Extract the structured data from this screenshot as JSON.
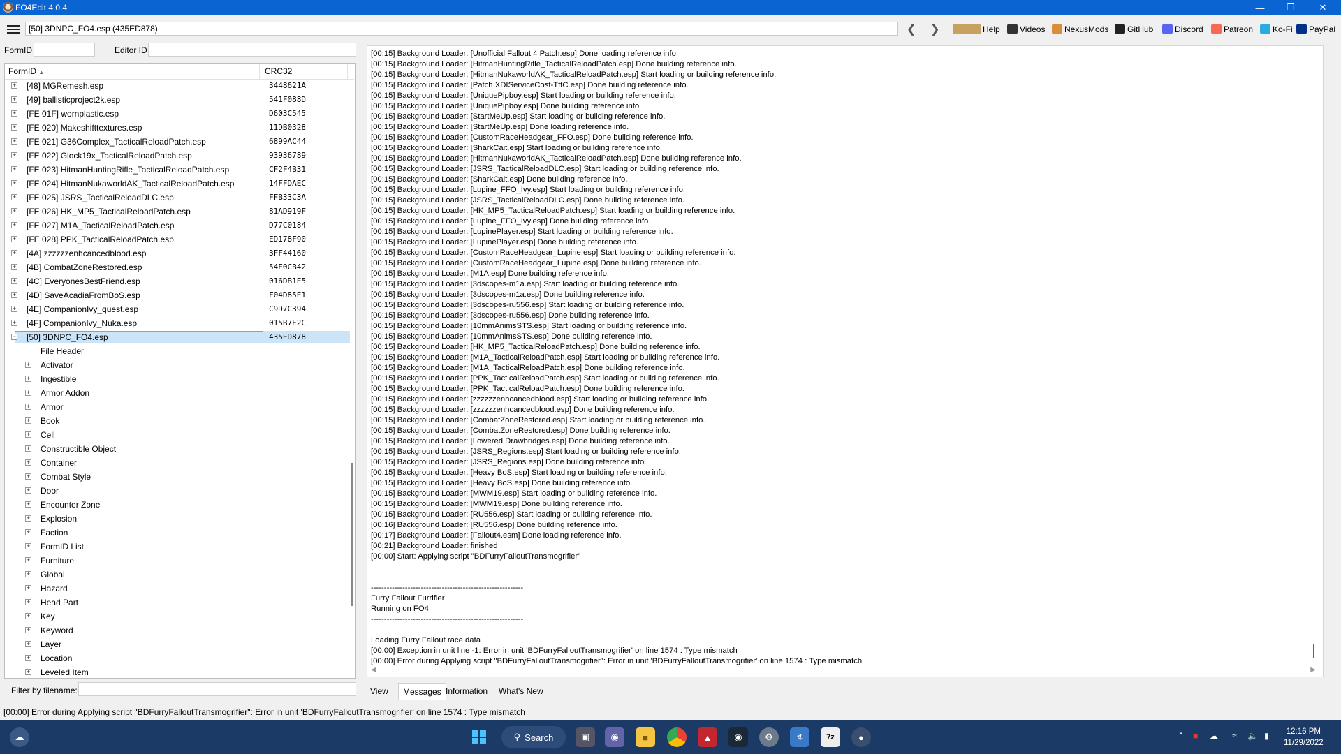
{
  "window": {
    "title": "FO4Edit 4.0.4"
  },
  "toolbar": {
    "path": "[50] 3DNPC_FO4.esp (435ED878)",
    "links": [
      {
        "label": "Help",
        "icon": "book-icon",
        "color": "#c8a060"
      },
      {
        "label": "Videos",
        "icon": "video-icon",
        "color": "#333333"
      },
      {
        "label": "NexusMods",
        "icon": "nexus-icon",
        "color": "#d98f3a"
      },
      {
        "label": "GitHub",
        "icon": "github-icon",
        "color": "#222222"
      },
      {
        "label": "Discord",
        "icon": "discord-icon",
        "color": "#5865f2"
      },
      {
        "label": "Patreon",
        "icon": "patreon-icon",
        "color": "#f96854"
      },
      {
        "label": "Ko-Fi",
        "icon": "kofi-icon",
        "color": "#29abe0"
      },
      {
        "label": "PayPal",
        "icon": "paypal-icon",
        "color": "#003087"
      }
    ]
  },
  "filters": {
    "formid_label": "FormID",
    "editorid_label": "Editor ID",
    "filename_label": "Filter by filename:"
  },
  "tree": {
    "col_formid": "FormID",
    "col_crc": "CRC32",
    "plugins": [
      {
        "name": "[48] MGRemesh.esp",
        "crc": "3448621A"
      },
      {
        "name": "[49] ballisticproject2k.esp",
        "crc": "541F088D"
      },
      {
        "name": "[FE 01F] wornplastic.esp",
        "crc": "D603C545"
      },
      {
        "name": "[FE 020] Makeshifttextures.esp",
        "crc": "11DB0328"
      },
      {
        "name": "[FE 021] G36Complex_TacticalReloadPatch.esp",
        "crc": "6899AC44"
      },
      {
        "name": "[FE 022] Glock19x_TacticalReloadPatch.esp",
        "crc": "93936789"
      },
      {
        "name": "[FE 023] HitmanHuntingRifle_TacticalReloadPatch.esp",
        "crc": "CF2F4B31"
      },
      {
        "name": "[FE 024] HitmanNukaworldAK_TacticalReloadPatch.esp",
        "crc": "14FFDAEC"
      },
      {
        "name": "[FE 025] JSRS_TacticalReloadDLC.esp",
        "crc": "FFB33C3A"
      },
      {
        "name": "[FE 026] HK_MP5_TacticalReloadPatch.esp",
        "crc": "81AD919F"
      },
      {
        "name": "[FE 027] M1A_TacticalReloadPatch.esp",
        "crc": "D77C0184"
      },
      {
        "name": "[FE 028] PPK_TacticalReloadPatch.esp",
        "crc": "ED178F90"
      },
      {
        "name": "[4A] zzzzzzenhcancedblood.esp",
        "crc": "3FF44160"
      },
      {
        "name": "[4B] CombatZoneRestored.esp",
        "crc": "54E0CB42"
      },
      {
        "name": "[4C] EveryonesBestFriend.esp",
        "crc": "016DB1E5"
      },
      {
        "name": "[4D] SaveAcadiaFromBoS.esp",
        "crc": "F04D85E1"
      },
      {
        "name": "[4E] CompanionIvy_quest.esp",
        "crc": "C9D7C394"
      },
      {
        "name": "[4F] CompanionIvy_Nuka.esp",
        "crc": "015B7E2C"
      }
    ],
    "selected": {
      "name": "[50] 3DNPC_FO4.esp",
      "crc": "435ED878"
    },
    "file_header": "File Header",
    "groups": [
      "Activator",
      "Ingestible",
      "Armor Addon",
      "Armor",
      "Book",
      "Cell",
      "Constructible Object",
      "Container",
      "Combat Style",
      "Door",
      "Encounter Zone",
      "Explosion",
      "Faction",
      "FormID List",
      "Furniture",
      "Global",
      "Hazard",
      "Head Part",
      "Key",
      "Keyword",
      "Layer",
      "Location",
      "Leveled Item"
    ]
  },
  "log": [
    "[00:15] Background Loader: [Unofficial Fallout 4 Patch.esp] Done loading reference info.",
    "[00:15] Background Loader: [HitmanHuntingRifle_TacticalReloadPatch.esp] Done building reference info.",
    "[00:15] Background Loader: [HitmanNukaworldAK_TacticalReloadPatch.esp] Start loading or building reference info.",
    "[00:15] Background Loader: [Patch XDIServiceCost-TftC.esp] Done building reference info.",
    "[00:15] Background Loader: [UniquePipboy.esp] Start loading or building reference info.",
    "[00:15] Background Loader: [UniquePipboy.esp] Done building reference info.",
    "[00:15] Background Loader: [StartMeUp.esp] Start loading or building reference info.",
    "[00:15] Background Loader: [StartMeUp.esp] Done loading reference info.",
    "[00:15] Background Loader: [CustomRaceHeadgear_FFO.esp] Done building reference info.",
    "[00:15] Background Loader: [SharkCait.esp] Start loading or building reference info.",
    "[00:15] Background Loader: [HitmanNukaworldAK_TacticalReloadPatch.esp] Done building reference info.",
    "[00:15] Background Loader: [JSRS_TacticalReloadDLC.esp] Start loading or building reference info.",
    "[00:15] Background Loader: [SharkCait.esp] Done building reference info.",
    "[00:15] Background Loader: [Lupine_FFO_Ivy.esp] Start loading or building reference info.",
    "[00:15] Background Loader: [JSRS_TacticalReloadDLC.esp] Done building reference info.",
    "[00:15] Background Loader: [HK_MP5_TacticalReloadPatch.esp] Start loading or building reference info.",
    "[00:15] Background Loader: [Lupine_FFO_Ivy.esp] Done building reference info.",
    "[00:15] Background Loader: [LupinePlayer.esp] Start loading or building reference info.",
    "[00:15] Background Loader: [LupinePlayer.esp] Done building reference info.",
    "[00:15] Background Loader: [CustomRaceHeadgear_Lupine.esp] Start loading or building reference info.",
    "[00:15] Background Loader: [CustomRaceHeadgear_Lupine.esp] Done building reference info.",
    "[00:15] Background Loader: [M1A.esp] Done building reference info.",
    "[00:15] Background Loader: [3dscopes-m1a.esp] Start loading or building reference info.",
    "[00:15] Background Loader: [3dscopes-m1a.esp] Done building reference info.",
    "[00:15] Background Loader: [3dscopes-ru556.esp] Start loading or building reference info.",
    "[00:15] Background Loader: [3dscopes-ru556.esp] Done building reference info.",
    "[00:15] Background Loader: [10mmAnimsSTS.esp] Start loading or building reference info.",
    "[00:15] Background Loader: [10mmAnimsSTS.esp] Done building reference info.",
    "[00:15] Background Loader: [HK_MP5_TacticalReloadPatch.esp] Done building reference info.",
    "[00:15] Background Loader: [M1A_TacticalReloadPatch.esp] Start loading or building reference info.",
    "[00:15] Background Loader: [M1A_TacticalReloadPatch.esp] Done building reference info.",
    "[00:15] Background Loader: [PPK_TacticalReloadPatch.esp] Start loading or building reference info.",
    "[00:15] Background Loader: [PPK_TacticalReloadPatch.esp] Done building reference info.",
    "[00:15] Background Loader: [zzzzzzenhcancedblood.esp] Start loading or building reference info.",
    "[00:15] Background Loader: [zzzzzzenhcancedblood.esp] Done building reference info.",
    "[00:15] Background Loader: [CombatZoneRestored.esp] Start loading or building reference info.",
    "[00:15] Background Loader: [CombatZoneRestored.esp] Done building reference info.",
    "[00:15] Background Loader: [Lowered Drawbridges.esp] Done building reference info.",
    "[00:15] Background Loader: [JSRS_Regions.esp] Start loading or building reference info.",
    "[00:15] Background Loader: [JSRS_Regions.esp] Done building reference info.",
    "[00:15] Background Loader: [Heavy BoS.esp] Start loading or building reference info.",
    "[00:15] Background Loader: [Heavy BoS.esp] Done building reference info.",
    "[00:15] Background Loader: [MWM19.esp] Start loading or building reference info.",
    "[00:15] Background Loader: [MWM19.esp] Done building reference info.",
    "[00:15] Background Loader: [RU556.esp] Start loading or building reference info.",
    "[00:16] Background Loader: [RU556.esp] Done building reference info.",
    "[00:17] Background Loader: [Fallout4.esm] Done loading reference info.",
    "[00:21] Background Loader: finished",
    "[00:00] Start: Applying script \"BDFurryFalloutTransmogrifier\"",
    "",
    "",
    "----------------------------------------------------------",
    "Furry Fallout Furrifier",
    "Running on FO4",
    "----------------------------------------------------------",
    "",
    "Loading Furry Fallout race data",
    "[00:00] Exception in unit  line -1: Error in unit 'BDFurryFalloutTransmogrifier' on line 1574 : Type mismatch",
    "[00:00] Error during Applying script \"BDFurryFalloutTransmogrifier\": Error in unit 'BDFurryFalloutTransmogrifier' on line 1574 : Type mismatch"
  ],
  "tabs": [
    "View",
    "Messages",
    "Information",
    "What's New"
  ],
  "active_tab": "Messages",
  "status": "[00:00] Error during Applying script \"BDFurryFalloutTransmogrifier\": Error in unit 'BDFurryFalloutTransmogrifier' on line 1574 : Type mismatch",
  "taskbar": {
    "search_label": "Search",
    "time": "12:16 PM",
    "date": "11/29/2022"
  }
}
